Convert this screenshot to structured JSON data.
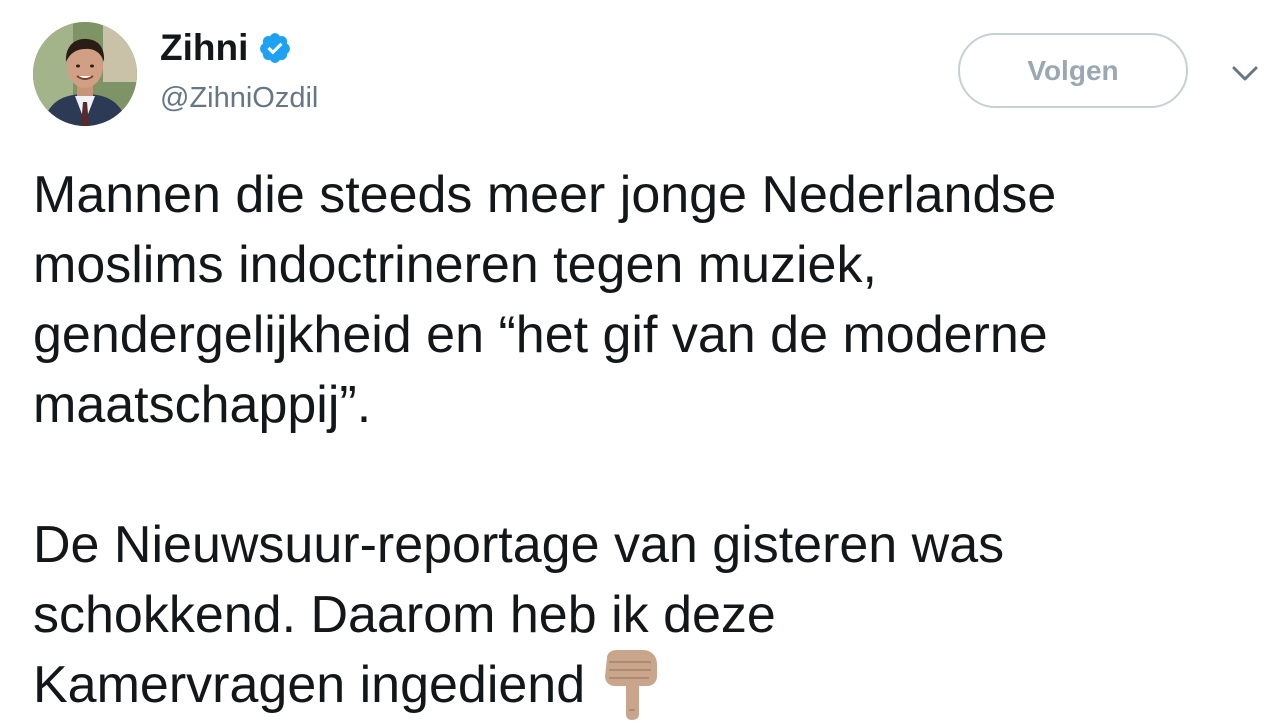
{
  "user": {
    "display_name": "Zihni",
    "handle": "@ZihniOzdil",
    "verified": true,
    "avatar_icon": "profile-photo"
  },
  "actions": {
    "follow_label": "Volgen",
    "menu_icon": "chevron-down-icon"
  },
  "tweet": {
    "paragraph1": "Mannen die steeds meer jonge Nederlandse\nmoslims indoctrineren tegen muziek,\ngendergelijkheid en “het gif van de moderne\nmaatschappij”.",
    "paragraph2": "De Nieuwsuur-reportage van gisteren was\nschokkend. Daarom heb ik deze\nKamervragen ingediend",
    "trailing_emoji": "backhand-index-pointing-down"
  },
  "colors": {
    "text": "#14171a",
    "secondary": "#657786",
    "verified_blue": "#1da1f2",
    "button_border": "#c6d0d8",
    "button_text": "#9aa8b4"
  }
}
